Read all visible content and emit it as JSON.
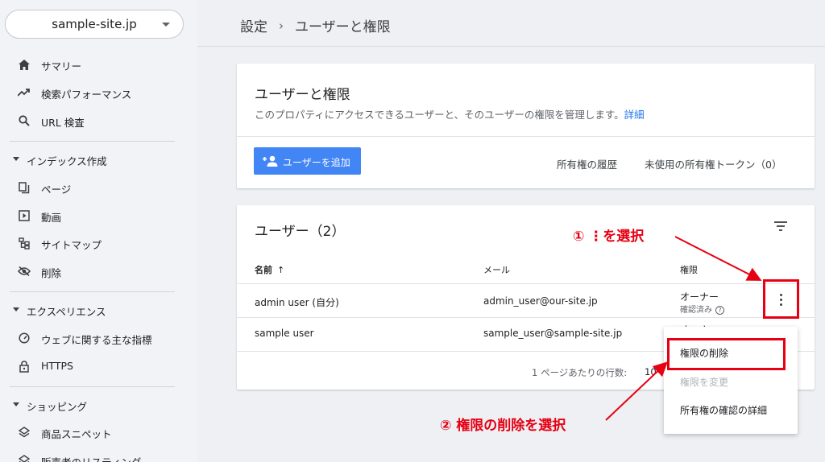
{
  "sidebar": {
    "site": "sample-site.jp",
    "items_top": [
      {
        "label": "サマリー",
        "icon": "home-icon"
      },
      {
        "label": "検索パフォーマンス",
        "icon": "trending-up-icon"
      },
      {
        "label": "URL 検査",
        "icon": "search-icon"
      }
    ],
    "sections": [
      {
        "title": "インデックス作成",
        "items": [
          {
            "label": "ページ",
            "icon": "pages-icon"
          },
          {
            "label": "動画",
            "icon": "video-icon"
          },
          {
            "label": "サイトマップ",
            "icon": "sitemap-icon"
          },
          {
            "label": "削除",
            "icon": "eye-off-icon"
          }
        ]
      },
      {
        "title": "エクスペリエンス",
        "items": [
          {
            "label": "ウェブに関する主な指標",
            "icon": "speed-icon"
          },
          {
            "label": "HTTPS",
            "icon": "lock-icon"
          }
        ]
      },
      {
        "title": "ショッピング",
        "items": [
          {
            "label": "商品スニペット",
            "icon": "layers-icon"
          },
          {
            "label": "販売者のリスティング",
            "icon": "layers-icon"
          }
        ]
      }
    ]
  },
  "breadcrumb": {
    "parent": "設定",
    "current": "ユーザーと権限"
  },
  "card_intro": {
    "title": "ユーザーと権限",
    "description": "このプロパティにアクセスできるユーザーと、そのユーザーの権限を管理します。",
    "details_link": "詳細",
    "add_user_button": "ユーザーを追加",
    "ownership_history": "所有権の履歴",
    "unused_tokens": "未使用の所有権トークン（0）"
  },
  "users_table": {
    "title": "ユーザー（2）",
    "columns": {
      "name": "名前",
      "email": "メール",
      "permission": "権限"
    },
    "sort_arrow": "↑",
    "rows": [
      {
        "name": "admin user (自分)",
        "email": "admin_user@our-site.jp",
        "permission": "オーナー",
        "status": "確認済み"
      },
      {
        "name": "sample user",
        "email": "sample_user@sample-site.jp",
        "permission": "オーナー",
        "status": ""
      }
    ],
    "rows_per_page_label": "1 ページあたりの行数:",
    "rows_per_page_value": "10"
  },
  "menu": {
    "items": [
      {
        "label": "権限の削除",
        "enabled": true
      },
      {
        "label": "権限を変更",
        "enabled": false
      },
      {
        "label": "所有権の確認の詳細",
        "enabled": true
      }
    ]
  },
  "annotations": {
    "step1": "① ⋮を選択",
    "step2": "② 権限の削除を選択",
    "color": "#e60012"
  }
}
